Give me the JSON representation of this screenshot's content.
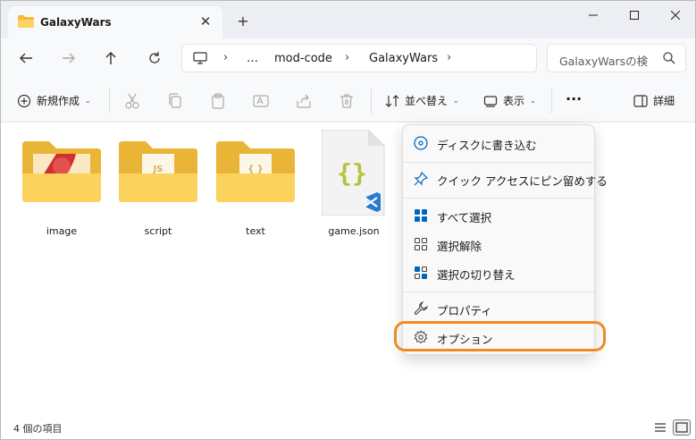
{
  "window": {
    "tab_title": "GalaxyWars",
    "new_tab": "+",
    "close_tab": "✕"
  },
  "address": {
    "crumbs": [
      "…",
      "mod-code",
      "GalaxyWars"
    ],
    "search_placeholder": "GalaxyWarsの検"
  },
  "toolbar": {
    "new_label": "新規作成",
    "sort_label": "並べ替え",
    "view_label": "表示",
    "details_label": "詳細",
    "more_label": "···"
  },
  "files": [
    {
      "name": "image",
      "type": "folder"
    },
    {
      "name": "script",
      "type": "folder"
    },
    {
      "name": "text",
      "type": "folder"
    },
    {
      "name": "game.json",
      "type": "json"
    }
  ],
  "status": {
    "count_label": "4 個の項目"
  },
  "context_menu": {
    "items": [
      {
        "label": "ディスクに書き込む",
        "icon": "disc-icon"
      },
      {
        "label": "クイック アクセスにピン留めする",
        "icon": "pin-icon"
      },
      {
        "label": "すべて選択",
        "icon": "select-all-icon"
      },
      {
        "label": "選択解除",
        "icon": "select-none-icon"
      },
      {
        "label": "選択の切り替え",
        "icon": "invert-selection-icon"
      },
      {
        "label": "プロパティ",
        "icon": "wrench-icon"
      },
      {
        "label": "オプション",
        "icon": "gear-icon"
      }
    ]
  },
  "colors": {
    "accent": "#0067c0",
    "folder": "#f8c948",
    "highlight": "#f08c1e"
  }
}
